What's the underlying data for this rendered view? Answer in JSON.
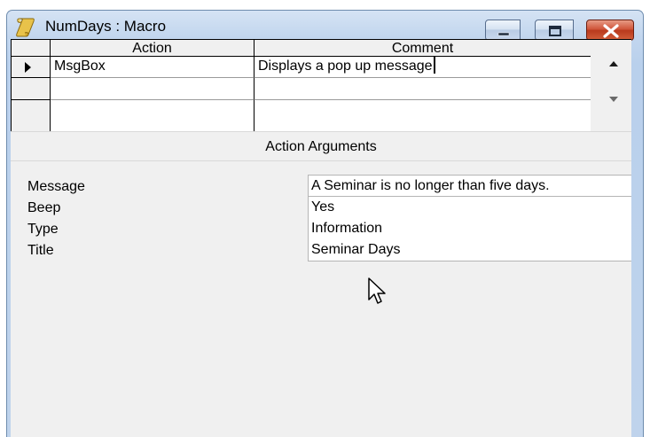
{
  "window": {
    "title": "NumDays : Macro",
    "icon": "macro-scroll-icon",
    "caption_buttons": [
      "minimize-icon",
      "maximize-icon",
      "close-icon"
    ]
  },
  "grid": {
    "columns": [
      "Action",
      "Comment"
    ],
    "rows": [
      {
        "action": "MsgBox",
        "comment": "Displays a pop up message",
        "current": true
      },
      {
        "action": "",
        "comment": "",
        "current": false
      }
    ]
  },
  "arguments": {
    "header": "Action Arguments",
    "items": [
      {
        "label": "Message",
        "value": "A Seminar is no longer than five days."
      },
      {
        "label": "Beep",
        "value": "Yes"
      },
      {
        "label": "Type",
        "value": "Information"
      },
      {
        "label": "Title",
        "value": "Seminar Days"
      }
    ]
  },
  "colors": {
    "title_bar": "#c2d6ee",
    "close_button": "#c74a2c",
    "panel_background": "#f0f0f0"
  }
}
